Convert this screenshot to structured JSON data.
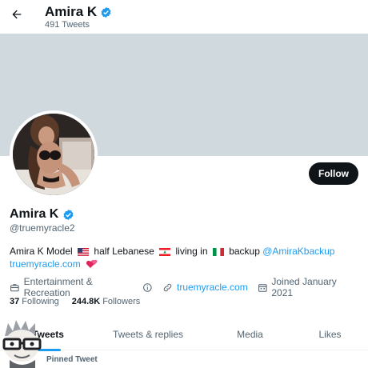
{
  "header": {
    "title": "Amira K",
    "tweet_count": "491 Tweets"
  },
  "profile": {
    "name": "Amira K",
    "handle": "@truemyracle2",
    "follow_label": "Follow",
    "bio": {
      "part1": "Amira K Model",
      "part2": "half Lebanese",
      "part3": "living in",
      "part4": "backup",
      "mention": "@AmiraKbackup",
      "website": "truemyracle.com"
    },
    "category": "Entertainment & Recreation",
    "website": "truemyracle.com",
    "joined": "Joined January 2021",
    "following_count": "37",
    "following_label": "Following",
    "followers_count": "244.8K",
    "followers_label": "Followers"
  },
  "tabs": [
    {
      "label": "Tweets"
    },
    {
      "label": "Tweets & replies"
    },
    {
      "label": "Media"
    },
    {
      "label": "Likes"
    }
  ],
  "pinned_label": "Pinned Tweet",
  "colors": {
    "accent": "#1d9bf0",
    "banner": "#cfd9de",
    "follow_button": "#0f1419"
  }
}
